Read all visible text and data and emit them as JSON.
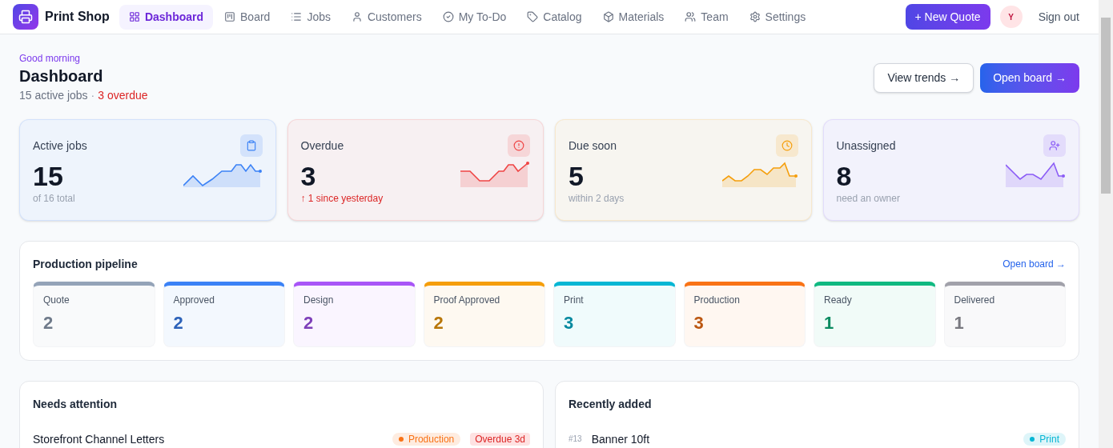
{
  "brand": "Print Shop",
  "nav": [
    {
      "label": "Dashboard",
      "selected": true
    },
    {
      "label": "Board",
      "selected": false
    },
    {
      "label": "Jobs",
      "selected": false
    },
    {
      "label": "Customers",
      "selected": false
    },
    {
      "label": "My To-Do",
      "selected": false
    },
    {
      "label": "Catalog",
      "selected": false
    },
    {
      "label": "Materials",
      "selected": false
    },
    {
      "label": "Team",
      "selected": false
    },
    {
      "label": "Settings",
      "selected": false
    }
  ],
  "new_quote": "+ New Quote",
  "avatar": "Y",
  "sign_out": "Sign out",
  "header": {
    "greeting": "Good morning",
    "title": "Dashboard",
    "summary": "15 active jobs",
    "separator": "·",
    "overdue": "3 overdue",
    "buttons": [
      "View trends →",
      "Open board →"
    ]
  },
  "stats": [
    {
      "label": "Active jobs",
      "value": "15",
      "note": "of 16 total",
      "alert": false,
      "color": "#3b82f6"
    },
    {
      "label": "Overdue",
      "value": "3",
      "note": "↑ 1 since yesterday",
      "alert": true,
      "color": "#ef4444"
    },
    {
      "label": "Due soon",
      "value": "5",
      "note": "within 2 days",
      "alert": false,
      "color": "#f59e0b"
    },
    {
      "label": "Unassigned",
      "value": "8",
      "note": "need an owner",
      "alert": false,
      "color": "#8b5cf6"
    }
  ],
  "pipeline": {
    "title": "Production pipeline",
    "link": "Open board →",
    "stages": [
      {
        "name": "Quote",
        "count": "2",
        "color": "#94a3b8"
      },
      {
        "name": "Approved",
        "count": "2",
        "color": "#3b82f6"
      },
      {
        "name": "Design",
        "count": "2",
        "color": "#a855f7"
      },
      {
        "name": "Proof Approved",
        "count": "2",
        "color": "#f59e0b"
      },
      {
        "name": "Print",
        "count": "3",
        "color": "#06b6d4"
      },
      {
        "name": "Production",
        "count": "3",
        "color": "#f97316"
      },
      {
        "name": "Ready",
        "count": "1",
        "color": "#10b981"
      },
      {
        "name": "Delivered",
        "count": "1",
        "color": "#a1a1aa"
      }
    ]
  },
  "attention": {
    "title": "Needs attention",
    "rows": [
      {
        "name": "Storefront Channel Letters",
        "stage": "Production",
        "color": "#f97316",
        "flag": "Overdue 3d"
      }
    ]
  },
  "recent": {
    "title": "Recently added",
    "rows": [
      {
        "number": "#13",
        "name": "Banner 10ft",
        "stage": "Print",
        "color": "#06b6d4"
      }
    ]
  }
}
